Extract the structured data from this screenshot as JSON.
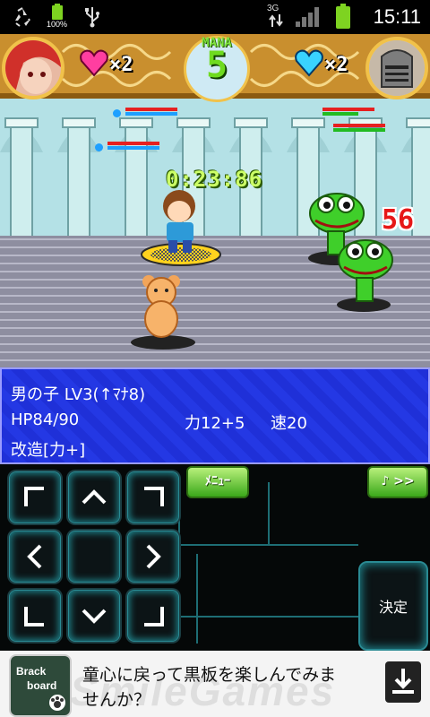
{
  "status_bar": {
    "battery_percent": "100%",
    "network": "3G",
    "time": "15:11"
  },
  "hud": {
    "lives_left": "×2",
    "lives_right": "×2",
    "mana_label": "MANA",
    "mana_value": "5",
    "timer": "0:23:86",
    "damage": "56"
  },
  "info_panel": {
    "line1": "男の子 LV3(↑ﾏﾅ8)",
    "line2_hp": "HP84/90",
    "line2_str": "力12+5",
    "line2_spd": "速20",
    "line3": "改造[力+]"
  },
  "controls": {
    "menu_label": "ﾒﾆｭｰ",
    "music_label": "♪ >>",
    "decide_label": "決定"
  },
  "ad": {
    "logo_line1": "Brack",
    "logo_line2": "board",
    "text_line1": "童心に戻って黒板を楽しんでみま",
    "text_line2": "せんか？"
  },
  "colors": {
    "panel_blue": "#2438e4",
    "panel_border": "#9a9cff",
    "timer_green": "#ccff66",
    "damage_red": "#e61818",
    "button_glow": "#1e7f87"
  }
}
